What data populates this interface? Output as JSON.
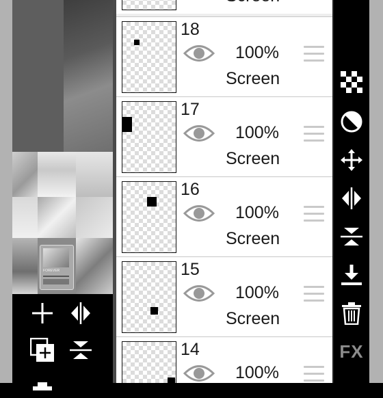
{
  "layers": [
    {
      "number": "",
      "opacity": "",
      "blend": "Screen",
      "partial": true
    },
    {
      "number": "18",
      "opacity": "100%",
      "blend": "Screen"
    },
    {
      "number": "17",
      "opacity": "100%",
      "blend": "Screen"
    },
    {
      "number": "16",
      "opacity": "100%",
      "blend": "Screen"
    },
    {
      "number": "15",
      "opacity": "100%",
      "blend": "Screen"
    },
    {
      "number": "14",
      "opacity": "100%",
      "blend": ""
    }
  ],
  "preview": {
    "music_title": "FOREVER"
  },
  "left_tools": [
    "add-layer-icon",
    "flip-horizontal-icon",
    "duplicate-layer-icon",
    "flip-vertical-icon"
  ],
  "right_tools": [
    "transparency-icon",
    "blend-mode-icon",
    "move-icon",
    "flip-horizontal-icon",
    "merge-down-icon",
    "import-icon",
    "delete-icon",
    "fx-icon"
  ],
  "right_tools_fx_label": "FX",
  "colors": {
    "panel_bg": "#eeeeee",
    "toolbar_bg": "#000000",
    "icon": "#ffffff",
    "fx": "#8c8c8c"
  }
}
